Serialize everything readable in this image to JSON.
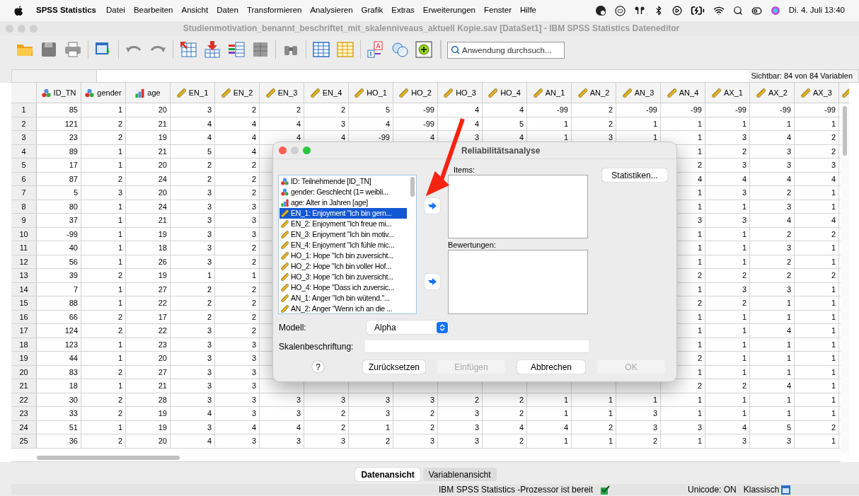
{
  "menu_bar": {
    "app": "SPSS Statistics",
    "items": [
      "Datei",
      "Bearbeiten",
      "Ansicht",
      "Daten",
      "Transformieren",
      "Analysieren",
      "Grafik",
      "Extras",
      "Erweiterungen",
      "Fenster",
      "Hilfe"
    ],
    "clock": "Di. 4. Juli 13:40"
  },
  "window": {
    "title": "Studienmotivation_benannt_beschriftet_mit_skalenniveaus_aktuell Kopie.sav [DataSet1] - IBM SPSS Statistics Dateneditor"
  },
  "toolbar": {
    "search": {
      "placeholder": "Anwendung durchsuch..."
    }
  },
  "visible_info": "Sichtbar: 84 von 84 Variablen",
  "table": {
    "columns": [
      {
        "label": "ID_TN",
        "kind": "nominal"
      },
      {
        "label": "gender",
        "kind": "nominal"
      },
      {
        "label": "age",
        "kind": "ordinal"
      },
      {
        "label": "EN_1",
        "kind": "scale"
      },
      {
        "label": "EN_2",
        "kind": "scale"
      },
      {
        "label": "EN_3",
        "kind": "scale"
      },
      {
        "label": "EN_4",
        "kind": "scale"
      },
      {
        "label": "HO_1",
        "kind": "scale"
      },
      {
        "label": "HO_2",
        "kind": "scale"
      },
      {
        "label": "HO_3",
        "kind": "scale"
      },
      {
        "label": "HO_4",
        "kind": "scale"
      },
      {
        "label": "AN_1",
        "kind": "scale"
      },
      {
        "label": "AN_2",
        "kind": "scale"
      },
      {
        "label": "AN_3",
        "kind": "scale"
      },
      {
        "label": "AN_4",
        "kind": "scale"
      },
      {
        "label": "AX_1",
        "kind": "scale"
      },
      {
        "label": "AX_2",
        "kind": "scale"
      },
      {
        "label": "AX_3",
        "kind": "scale"
      },
      {
        "kind": "scale"
      }
    ],
    "rows": [
      {
        "number": "1",
        "cells": [
          "85",
          "1",
          "20",
          "3",
          "2",
          "2",
          "2",
          "5",
          "-99",
          "4",
          "4",
          "-99",
          "2",
          "-99",
          "-99",
          "-99",
          "-99",
          "-99"
        ]
      },
      {
        "number": "2",
        "cells": [
          "121",
          "2",
          "21",
          "4",
          "4",
          "4",
          "3",
          "4",
          "-99",
          "4",
          "5",
          "1",
          "2",
          "1",
          "1",
          "1",
          "1",
          "1"
        ]
      },
      {
        "number": "3",
        "cells": [
          "23",
          "2",
          "19",
          "4",
          "4",
          "4",
          "4",
          "-99",
          "4",
          "3",
          "4",
          "1",
          "3",
          "1",
          "1",
          "3",
          "4",
          "2"
        ]
      },
      {
        "number": "4",
        "cells": [
          "89",
          "1",
          "21",
          "5",
          "4",
          null,
          null,
          null,
          null,
          null,
          null,
          null,
          null,
          null,
          "1",
          "2",
          "3",
          "2"
        ]
      },
      {
        "number": "5",
        "cells": [
          "17",
          "1",
          "20",
          "2",
          "2",
          null,
          null,
          null,
          null,
          null,
          null,
          null,
          null,
          null,
          "2",
          "3",
          "3",
          "3"
        ]
      },
      {
        "number": "6",
        "cells": [
          "87",
          "2",
          "24",
          "2",
          "2",
          null,
          null,
          null,
          null,
          null,
          null,
          null,
          null,
          null,
          "4",
          "4",
          "4",
          "4"
        ]
      },
      {
        "number": "7",
        "cells": [
          "5",
          "3",
          "20",
          "3",
          "2",
          null,
          null,
          null,
          null,
          null,
          null,
          null,
          null,
          null,
          "1",
          "3",
          "2",
          "1"
        ]
      },
      {
        "number": "8",
        "cells": [
          "80",
          "1",
          "24",
          "3",
          "3",
          null,
          null,
          null,
          null,
          null,
          null,
          null,
          null,
          null,
          "1",
          "1",
          "3",
          "1"
        ]
      },
      {
        "number": "9",
        "cells": [
          "37",
          "1",
          "21",
          "3",
          "3",
          null,
          null,
          null,
          null,
          null,
          null,
          null,
          null,
          null,
          "3",
          "3",
          "4",
          "4"
        ]
      },
      {
        "number": "10",
        "cells": [
          "-99",
          "1",
          "19",
          "3",
          "3",
          null,
          null,
          null,
          null,
          null,
          null,
          null,
          null,
          null,
          "1",
          "1",
          "2",
          "2"
        ]
      },
      {
        "number": "11",
        "cells": [
          "40",
          "1",
          "18",
          "3",
          "2",
          null,
          null,
          null,
          null,
          null,
          null,
          null,
          null,
          null,
          "1",
          "1",
          "3",
          "1"
        ]
      },
      {
        "number": "12",
        "cells": [
          "56",
          "1",
          "26",
          "3",
          "2",
          null,
          null,
          null,
          null,
          null,
          null,
          null,
          null,
          null,
          "1",
          "1",
          "2",
          "1"
        ]
      },
      {
        "number": "13",
        "cells": [
          "39",
          "2",
          "19",
          "1",
          "1",
          null,
          null,
          null,
          null,
          null,
          null,
          null,
          null,
          null,
          "2",
          "2",
          "2",
          "2"
        ]
      },
      {
        "number": "14",
        "cells": [
          "7",
          "1",
          "27",
          "2",
          "2",
          null,
          null,
          null,
          null,
          null,
          null,
          null,
          null,
          null,
          "1",
          "3",
          "3",
          "1"
        ]
      },
      {
        "number": "15",
        "cells": [
          "88",
          "1",
          "22",
          "2",
          "2",
          null,
          null,
          null,
          null,
          null,
          null,
          null,
          null,
          null,
          "2",
          "2",
          "1",
          "1"
        ]
      },
      {
        "number": "16",
        "cells": [
          "66",
          "2",
          "17",
          "2",
          "2",
          null,
          null,
          null,
          null,
          null,
          null,
          null,
          null,
          null,
          "1",
          "1",
          "1",
          "1"
        ]
      },
      {
        "number": "17",
        "cells": [
          "124",
          "2",
          "22",
          "3",
          "2",
          null,
          null,
          null,
          null,
          null,
          null,
          null,
          null,
          null,
          "1",
          "1",
          "4",
          "1"
        ]
      },
      {
        "number": "18",
        "cells": [
          "123",
          "1",
          "23",
          "3",
          "3",
          null,
          null,
          null,
          null,
          null,
          null,
          null,
          null,
          null,
          "1",
          "1",
          "1",
          "1"
        ]
      },
      {
        "number": "19",
        "cells": [
          "44",
          "1",
          "20",
          "3",
          "3",
          null,
          null,
          null,
          null,
          null,
          null,
          null,
          null,
          null,
          "2",
          "1",
          "1",
          "1"
        ]
      },
      {
        "number": "20",
        "cells": [
          "83",
          "2",
          "27",
          "3",
          "3",
          null,
          null,
          null,
          null,
          null,
          null,
          null,
          null,
          null,
          "1",
          "1",
          "1",
          "1"
        ]
      },
      {
        "number": "21",
        "cells": [
          "18",
          "1",
          "21",
          "3",
          "3",
          null,
          null,
          null,
          null,
          null,
          null,
          null,
          null,
          null,
          "2",
          "2",
          "4",
          "1"
        ]
      },
      {
        "number": "22",
        "cells": [
          "30",
          "2",
          "28",
          "3",
          "3",
          "3",
          "3",
          "3",
          "3",
          "2",
          "2",
          "1",
          "1",
          "1",
          "1",
          "1",
          "1",
          "1"
        ]
      },
      {
        "number": "23",
        "cells": [
          "33",
          "2",
          "19",
          "4",
          "3",
          "3",
          "2",
          "3",
          "2",
          "3",
          "2",
          "1",
          "1",
          "3",
          "1",
          "1",
          "1",
          "1"
        ]
      },
      {
        "number": "24",
        "cells": [
          "51",
          "1",
          "19",
          "3",
          "4",
          "4",
          "2",
          "1",
          "2",
          "3",
          "4",
          "4",
          "2",
          "3",
          "3",
          "4",
          "5",
          "2"
        ]
      },
      {
        "number": "25",
        "cells": [
          "36",
          "2",
          "20",
          "4",
          "3",
          "3",
          "3",
          "2",
          "3",
          "3",
          "2",
          "1",
          "1",
          "2",
          "1",
          "3",
          "3",
          "1"
        ]
      }
    ]
  },
  "dialog": {
    "title": "Reliabilitätsanalyse",
    "variables": [
      {
        "label": "ID: Teilnehmende [ID_TN]",
        "kind": "nominal",
        "selected": false
      },
      {
        "label": "gender: Geschlecht (1= weibli...",
        "kind": "nominal",
        "selected": false
      },
      {
        "label": "age: Alter in Jahren [age]",
        "kind": "ordinal",
        "selected": false
      },
      {
        "label": "EN_1: Enjoyment \"Ich bin gern...",
        "kind": "scale",
        "selected": true
      },
      {
        "label": "EN_2: Enjoyment \"Ich freue mi...",
        "kind": "scale",
        "selected": false
      },
      {
        "label": "EN_3: Enjoyment \"Ich bin motiv...",
        "kind": "scale",
        "selected": false
      },
      {
        "label": "EN_4: Enjoyment \"Ich fühle mic...",
        "kind": "scale",
        "selected": false
      },
      {
        "label": "HO_1: Hope \"Ich bin zuversicht...",
        "kind": "scale",
        "selected": false
      },
      {
        "label": "HO_2: Hope \"Ich bin voller Hof...",
        "kind": "scale",
        "selected": false
      },
      {
        "label": "HO_3: Hope \"Ich bin zuversicht...",
        "kind": "scale",
        "selected": false
      },
      {
        "label": "HO_4: Hope \"Dass ich zuversic...",
        "kind": "scale",
        "selected": false
      },
      {
        "label": "AN_1: Anger  \"Ich bin wütend.\"...",
        "kind": "scale",
        "selected": false
      },
      {
        "label": "AN_2: Anger \"Wenn ich an die ...",
        "kind": "scale",
        "selected": false
      }
    ],
    "items_label": "Items:",
    "ratings_label": "Bewertungen:",
    "statistics_button": "Statistiken...",
    "model": {
      "label": "Modell:",
      "value": "Alpha"
    },
    "scale_label": {
      "label": "Skalenbeschriftung:"
    },
    "help": "?",
    "buttons": [
      {
        "label": "Zurücksetzen",
        "disabled": false
      },
      {
        "label": "Einfügen",
        "disabled": true
      },
      {
        "label": "Abbrechen",
        "disabled": false
      },
      {
        "label": "OK",
        "disabled": true
      }
    ]
  },
  "view_tabs": [
    {
      "label": "Datenansicht",
      "selected": true
    },
    {
      "label": "Variablenansicht",
      "selected": false
    }
  ],
  "status_bar": {
    "processor": "IBM SPSS Statistics -Prozessor ist bereit",
    "encoding": "Unicode: ON",
    "mode": "Klassisch"
  }
}
